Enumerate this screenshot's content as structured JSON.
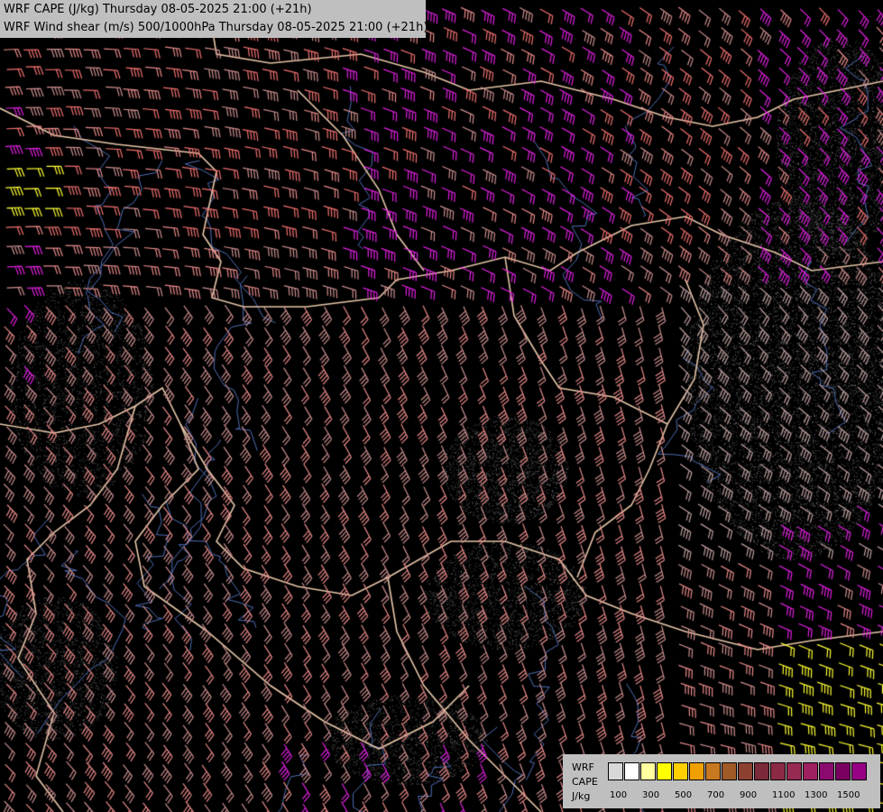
{
  "header": {
    "line1": "WRF CAPE (J/kg) Thursday 08-05-2025 21:00 (+21h)",
    "line2": "WRF Wind shear (m/s) 500/1000hPa Thursday 08-05-2025 21:00 (+21h)"
  },
  "legend": {
    "label_model": "WRF",
    "label_field": "CAPE",
    "label_unit": "J/kg",
    "tick_labels": [
      "100",
      "300",
      "500",
      "700",
      "900",
      "1100",
      "1300",
      "1500"
    ],
    "colors": [
      "#d8d8d8",
      "#ffffff",
      "#ffffa0",
      "#ffff00",
      "#ffd000",
      "#f0a000",
      "#c87820",
      "#a05a28",
      "#8c4030",
      "#7a2a38",
      "#8a2a45",
      "#962a52",
      "#9e2060",
      "#8a0a70",
      "#7a0060",
      "#960082"
    ]
  },
  "map": {
    "shear_colors": [
      "#cc8e8e",
      "#e88a8a",
      "#f07070",
      "#e020e0",
      "#ffff33",
      "#c0a0a0"
    ],
    "border_color": "#e7c6a8",
    "river_color": "#4f6db5",
    "background": "#000000"
  }
}
